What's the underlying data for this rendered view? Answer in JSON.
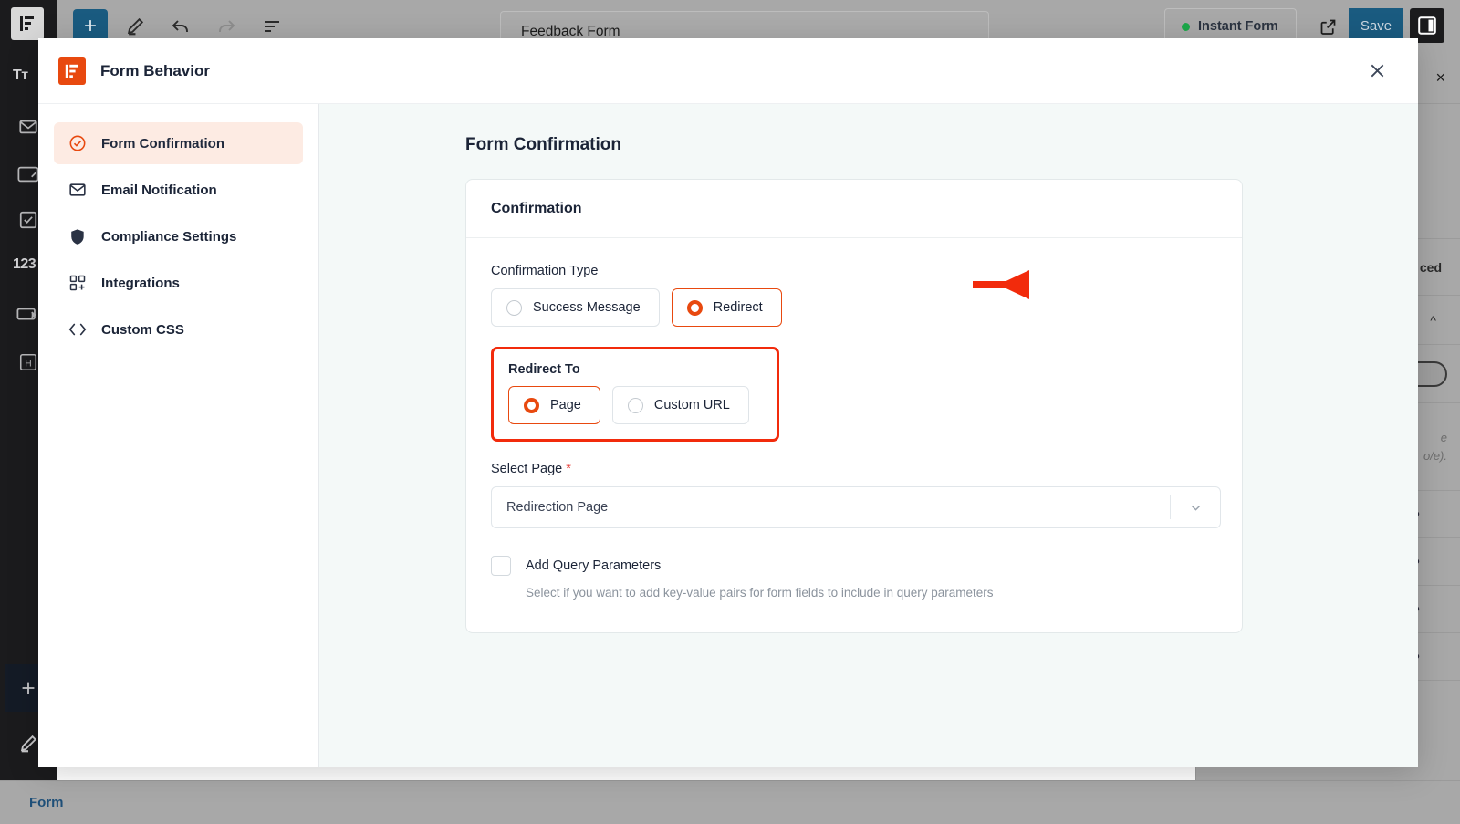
{
  "app": {
    "toolbar": {
      "add_label": "+",
      "form_title": "Feedback Form",
      "instant_form_label": "Instant Form",
      "save_label": "Save",
      "icons": [
        "plus-icon",
        "pencil-icon",
        "undo-icon",
        "redo-icon",
        "list-view-icon",
        "external-link-icon",
        "sidebar-toggle-icon",
        "more-options-icon"
      ]
    },
    "left_rail": {
      "logo": "fluent-forms-logo",
      "items": [
        {
          "icon": "text-icon",
          "label": "Tт"
        },
        {
          "icon": "email-icon",
          "label": ""
        },
        {
          "icon": "textarea-icon",
          "label": ""
        },
        {
          "icon": "checkbox-icon",
          "label": ""
        },
        {
          "icon": "number-icon",
          "label": "123"
        },
        {
          "icon": "submit-button-icon",
          "label": ""
        },
        {
          "icon": "heading-icon",
          "label": "H"
        }
      ],
      "add_label": "+",
      "pencil_label": ""
    },
    "inspector": {
      "close_label": "×",
      "advanced_label": "ced",
      "collapse_label": "^",
      "note_line1": "e",
      "note_line2": "o/e).",
      "row_dots": "•••"
    },
    "bottom_bar": {
      "label": "Form"
    }
  },
  "modal": {
    "title": "Form Behavior",
    "brand_color": "#E8490F",
    "close_label": "×",
    "sidebar": {
      "items": [
        {
          "label": "Form Confirmation",
          "icon": "check-circle-icon",
          "active": true
        },
        {
          "label": "Email Notification",
          "icon": "envelope-icon",
          "active": false
        },
        {
          "label": "Compliance Settings",
          "icon": "shield-icon",
          "active": false
        },
        {
          "label": "Integrations",
          "icon": "grid-plus-icon",
          "active": false
        },
        {
          "label": "Custom CSS",
          "icon": "code-brackets-icon",
          "active": false
        }
      ]
    },
    "content": {
      "page_title": "Form Confirmation",
      "card_title": "Confirmation",
      "confirmation_type": {
        "label": "Confirmation Type",
        "options": [
          {
            "label": "Success Message",
            "selected": false
          },
          {
            "label": "Redirect",
            "selected": true
          }
        ]
      },
      "redirect_to": {
        "label": "Redirect To",
        "highlight_color": "#F22B0C",
        "options": [
          {
            "label": "Page",
            "selected": true
          },
          {
            "label": "Custom URL",
            "selected": false
          }
        ]
      },
      "select_page": {
        "label": "Select Page",
        "required_marker": "*",
        "value": "Redirection Page",
        "chevron": "chevron-down-icon"
      },
      "query_params": {
        "label": "Add Query Parameters",
        "checked": false,
        "help": "Select if you want to add key-value pairs for form fields to include in query parameters"
      }
    },
    "annotation": {
      "arrow_color": "#F22B0C",
      "points_to": "Redirect"
    }
  }
}
